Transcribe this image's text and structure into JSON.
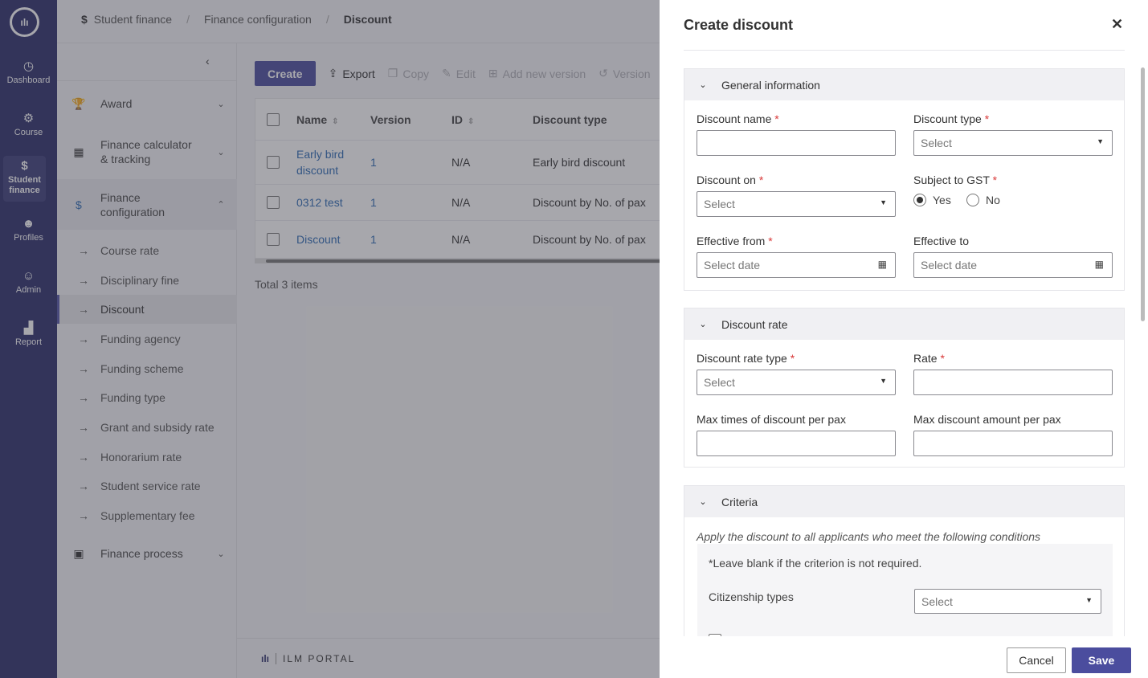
{
  "rail": {
    "items": [
      {
        "label": "Dashboard",
        "icon": "dashboard-icon"
      },
      {
        "label": "Course",
        "icon": "course-icon"
      },
      {
        "label": "Student finance",
        "icon": "dollar-icon"
      },
      {
        "label": "Profiles",
        "icon": "profiles-icon"
      },
      {
        "label": "Admin",
        "icon": "admin-icon"
      },
      {
        "label": "Report",
        "icon": "report-icon"
      }
    ],
    "active": "Student finance"
  },
  "breadcrumb": {
    "items": [
      "Student finance",
      "Finance configuration",
      "Discount"
    ]
  },
  "sidebar": {
    "groups": [
      {
        "label": "Award"
      },
      {
        "label": "Finance calculator & tracking"
      },
      {
        "label": "Finance configuration"
      },
      {
        "label": "Finance process"
      }
    ],
    "sub_items": [
      {
        "label": "Course rate"
      },
      {
        "label": "Disciplinary fine"
      },
      {
        "label": "Discount"
      },
      {
        "label": "Funding agency"
      },
      {
        "label": "Funding scheme"
      },
      {
        "label": "Funding type"
      },
      {
        "label": "Grant and subsidy rate"
      },
      {
        "label": "Honorarium rate"
      },
      {
        "label": "Student service rate"
      },
      {
        "label": "Supplementary fee"
      }
    ]
  },
  "toolbar": {
    "create": "Create",
    "export": "Export",
    "copy": "Copy",
    "edit": "Edit",
    "add_version": "Add new version",
    "version": "Version"
  },
  "table": {
    "headers": [
      "Name",
      "Version",
      "ID",
      "Discount type"
    ],
    "rows": [
      {
        "name": "Early bird discount",
        "version": "1",
        "id": "N/A",
        "type": "Early bird discount"
      },
      {
        "name": "0312 test",
        "version": "1",
        "id": "N/A",
        "type": "Discount by No. of pax"
      },
      {
        "name": "Discount",
        "version": "1",
        "id": "N/A",
        "type": "Discount by No. of pax"
      }
    ],
    "total": "Total 3 items"
  },
  "footer": {
    "brand": "ILM PORTAL"
  },
  "drawer": {
    "title": "Create discount",
    "general": {
      "title": "General information",
      "discount_name": "Discount name",
      "discount_type": "Discount type",
      "discount_on": "Discount on",
      "subject_gst": "Subject to GST",
      "yes": "Yes",
      "no": "No",
      "effective_from": "Effective from",
      "effective_to": "Effective to",
      "select": "Select",
      "select_date": "Select date"
    },
    "rate": {
      "title": "Discount rate",
      "rate_type": "Discount rate type",
      "rate": "Rate",
      "max_times": "Max times of discount per pax",
      "max_amount": "Max discount amount per pax"
    },
    "criteria": {
      "title": "Criteria",
      "note": "Apply the discount to all applicants who meet the following conditions",
      "blank_note": "*Leave blank if the criterion is not required.",
      "citizenship": "Citizenship types"
    },
    "cancel": "Cancel",
    "save": "Save"
  }
}
